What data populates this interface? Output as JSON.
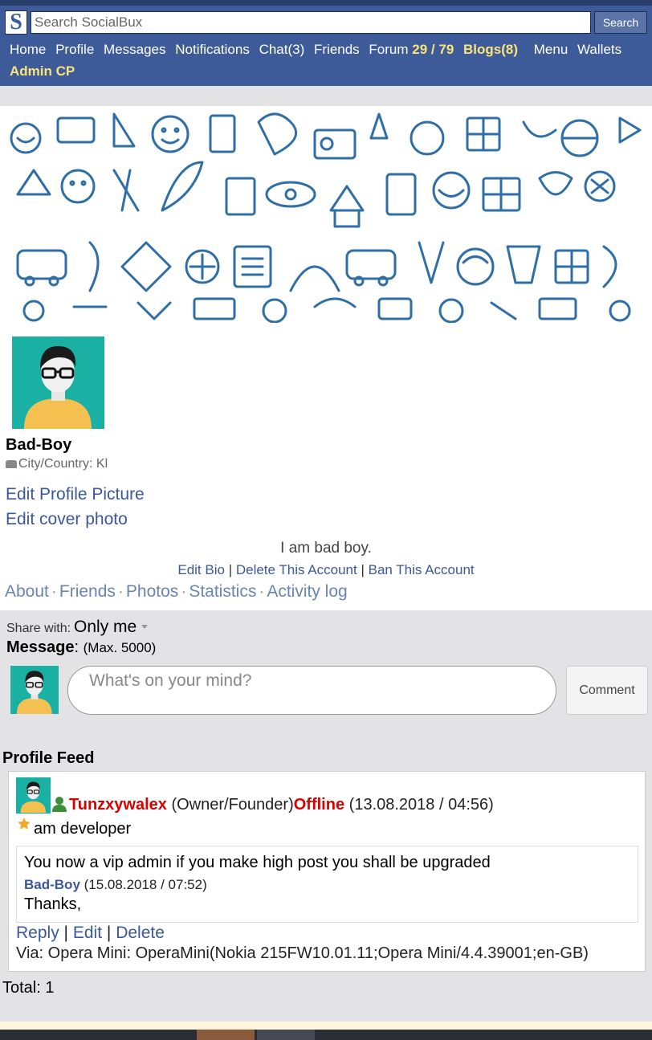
{
  "header": {
    "logo_letter": "S",
    "search_placeholder": "Search SocialBux",
    "search_button": "Search",
    "nav": {
      "home": "Home",
      "profile": "Profile",
      "messages": "Messages",
      "notifications": "Notifications",
      "chat": "Chat(3)",
      "friends": "Friends",
      "forum": "Forum",
      "forum_count": "29 / 79",
      "blogs": "Blogs(8)",
      "menu": "Menu",
      "wallets": "Wallets",
      "admin": "Admin CP"
    }
  },
  "profile": {
    "name": "Bad-Boy",
    "city": "City/Country: Kl",
    "edit_picture": "Edit Profile Picture",
    "edit_cover": "Edit cover photo",
    "bio": "I am bad boy.",
    "bio_actions": {
      "edit_bio": "Edit Bio",
      "delete_account": "Delete This Account",
      "ban_account": "Ban This Account",
      "separator": "|"
    },
    "tabs": {
      "about": "About",
      "friends": "Friends",
      "photos": "Photos",
      "statistics": "Statistics",
      "activity": "Activity log",
      "separator": "·"
    }
  },
  "composer": {
    "share_label": "Share with:",
    "share_value": "Only me",
    "message_label": "Message",
    "message_max": "(Max. 5000)",
    "placeholder": "What's on your mind?",
    "comment_button": "Comment"
  },
  "feed": {
    "title": "Profile Feed",
    "post": {
      "author": "Tunzxywalex",
      "role": "(Owner/Founder)",
      "status": "Offline",
      "timestamp": "(13.08.2018 / 04:56)",
      "body": "am developer",
      "quote_text": "You now a vip admin if you make high post you shall be upgraded",
      "quote_author": "Bad-Boy",
      "quote_time": "(15.08.2018 / 07:52)",
      "quote_reply": "Thanks,",
      "actions": {
        "reply": "Reply",
        "edit": "Edit",
        "delete": "Delete",
        "separator": "|"
      },
      "via": "Via: Opera Mini: OperaMini(Nokia 215FW10.01.11;Opera Mini/4.4.39001;en-GB)"
    },
    "total": "Total: 1"
  },
  "colors": {
    "header_bg": "#3e5b99",
    "highlight": "#f9e37a",
    "link": "#3b5898",
    "offline": "#d90000",
    "avatar_bg": "#1ab0a4"
  }
}
